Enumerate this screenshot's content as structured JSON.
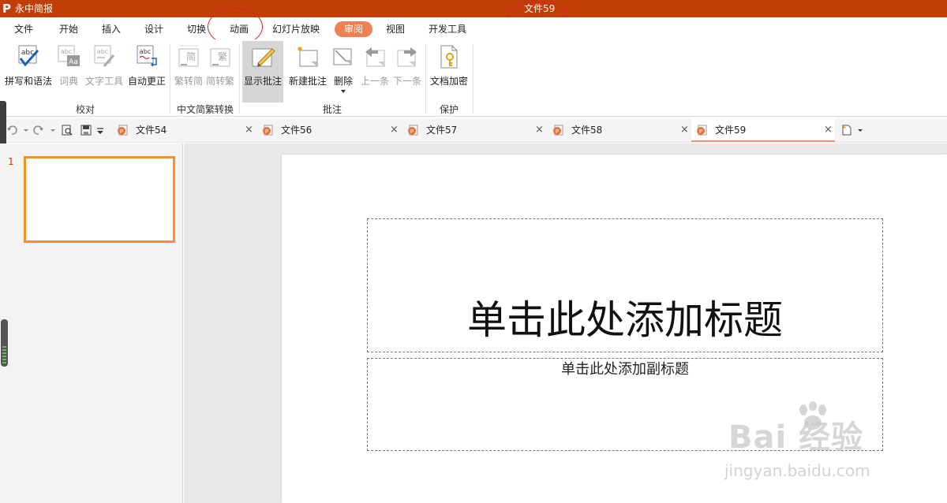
{
  "title_bar": {
    "app_logo": "P",
    "app_name": "永中简报",
    "doc_title": "文件59",
    "bg_color": "#c13e07"
  },
  "menu": {
    "items": [
      "文件",
      "开始",
      "插入",
      "设计",
      "切换",
      "动画",
      "幻灯片放映",
      "审阅",
      "视图",
      "开发工具"
    ],
    "active": "审阅",
    "active_color": "#f07f54"
  },
  "ribbon": {
    "groups": [
      {
        "label": "校对",
        "buttons": [
          {
            "label": "拼写和语法",
            "icon": "spellcheck-icon",
            "enabled": true
          },
          {
            "label": "词典",
            "icon": "dictionary-icon",
            "enabled": false
          },
          {
            "label": "文字工具",
            "icon": "text-tool-icon",
            "enabled": false
          },
          {
            "label": "自动更正",
            "icon": "autocorrect-icon",
            "enabled": true
          }
        ]
      },
      {
        "label": "中文简繁转换",
        "buttons": [
          {
            "label": "繁转简",
            "icon": "trad-to-simp-icon",
            "glyph": "简",
            "enabled": false
          },
          {
            "label": "简转繁",
            "icon": "simp-to-trad-icon",
            "glyph": "繁",
            "enabled": false
          }
        ]
      },
      {
        "label": "批注",
        "buttons": [
          {
            "label": "显示批注",
            "icon": "show-comments-icon",
            "enabled": true
          },
          {
            "label": "新建批注",
            "icon": "new-comment-icon",
            "enabled": true
          },
          {
            "label": "删除",
            "icon": "delete-comment-icon",
            "enabled": true
          },
          {
            "label": "上一条",
            "icon": "previous-comment-icon",
            "enabled": false
          },
          {
            "label": "下一条",
            "icon": "next-comment-icon",
            "enabled": false
          }
        ]
      },
      {
        "label": "保护",
        "buttons": [
          {
            "label": "文档加密",
            "icon": "document-encrypt-icon",
            "enabled": true
          }
        ]
      }
    ]
  },
  "tabs": [
    {
      "name": "文件54",
      "active": false
    },
    {
      "name": "文件56",
      "active": false
    },
    {
      "name": "文件57",
      "active": false
    },
    {
      "name": "文件58",
      "active": false
    },
    {
      "name": "文件59",
      "active": true
    }
  ],
  "tab_close_glyph": "×",
  "slides_pane": {
    "slides": [
      {
        "number": "1",
        "selected": true
      }
    ],
    "selected_color": "#f39325"
  },
  "slide": {
    "title_placeholder": "单击此处添加标题",
    "subtitle_placeholder": "单击此处添加副标题"
  },
  "watermark": {
    "main": "Bai  经验",
    "sub": "jingyan.baidu.com"
  }
}
